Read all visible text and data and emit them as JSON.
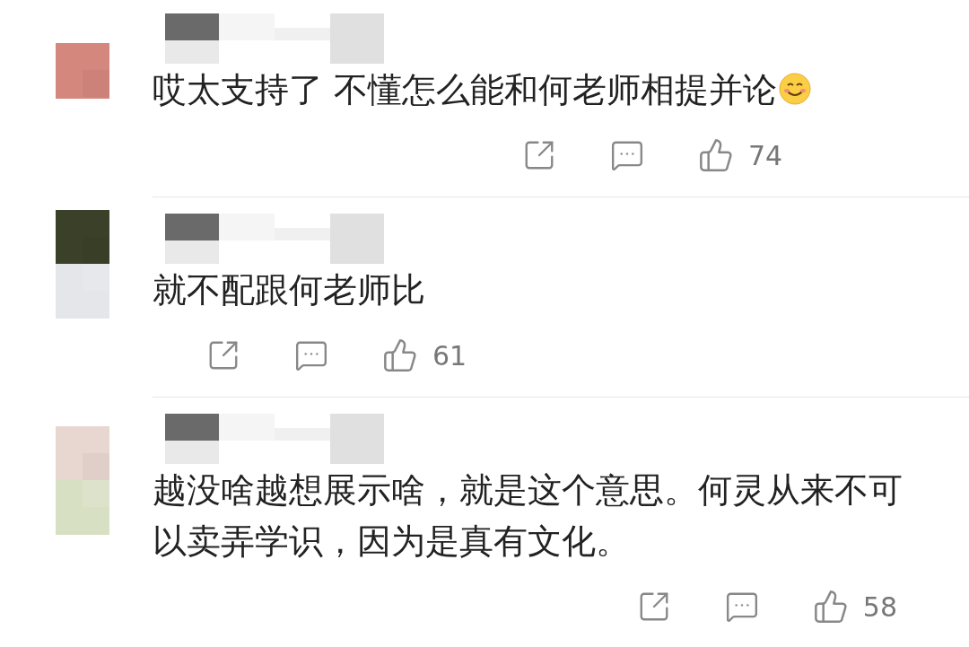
{
  "comments": [
    {
      "text": "哎太支持了 不懂怎么能和何老师相提并论",
      "emoji": true,
      "likes": "74"
    },
    {
      "text": "就不配跟何老师比",
      "emoji": false,
      "likes": "61"
    },
    {
      "text": "越没啥越想展示啥，就是这个意思。何灵从来不可以卖弄学识，因为是真有文化。",
      "emoji": false,
      "likes": "58"
    }
  ]
}
